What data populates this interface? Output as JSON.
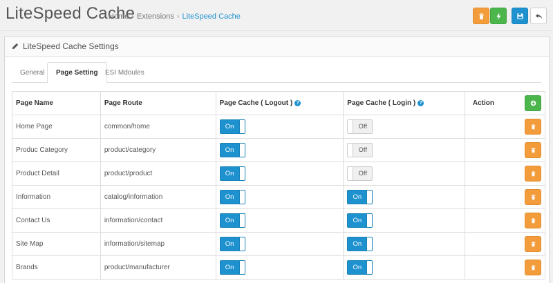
{
  "header": {
    "title": "LiteSpeed Cache",
    "breadcrumb": [
      "Home",
      "Extensions",
      "LiteSpeed Cache"
    ],
    "breadcrumb_separator": "›"
  },
  "panel": {
    "title": "LiteSpeed Cache Settings"
  },
  "tabs": [
    "General",
    "Page Setting",
    "ESI Mdoules"
  ],
  "active_tab": "Page Setting",
  "table": {
    "columns": {
      "name": "Page Name",
      "route": "Page Route",
      "logout": "Page Cache ( Logout )",
      "login": "Page Cache ( Login )",
      "action": "Action"
    },
    "rows": [
      {
        "name": "Home Page",
        "route": "common/home",
        "logout": "On",
        "login": "Off"
      },
      {
        "name": "Produc Category",
        "route": "product/category",
        "logout": "On",
        "login": "Off"
      },
      {
        "name": "Product Detail",
        "route": "product/product",
        "logout": "On",
        "login": "Off"
      },
      {
        "name": "Information",
        "route": "catalog/information",
        "logout": "On",
        "login": "On"
      },
      {
        "name": "Contact Us",
        "route": "information/contact",
        "logout": "On",
        "login": "On"
      },
      {
        "name": "Site Map",
        "route": "information/sitemap",
        "logout": "On",
        "login": "On"
      },
      {
        "name": "Brands",
        "route": "product/manufacturer",
        "logout": "On",
        "login": "On"
      }
    ]
  },
  "colors": {
    "primary": "#1e91cf",
    "warning": "#f39c3c",
    "success": "#4cb64c"
  },
  "icons": {
    "delete": "trash-icon",
    "purge": "bolt-icon",
    "save": "save-icon",
    "back": "reply-icon",
    "add": "plus-circle-icon",
    "edit": "pencil-icon",
    "help": "question-circle-icon"
  }
}
